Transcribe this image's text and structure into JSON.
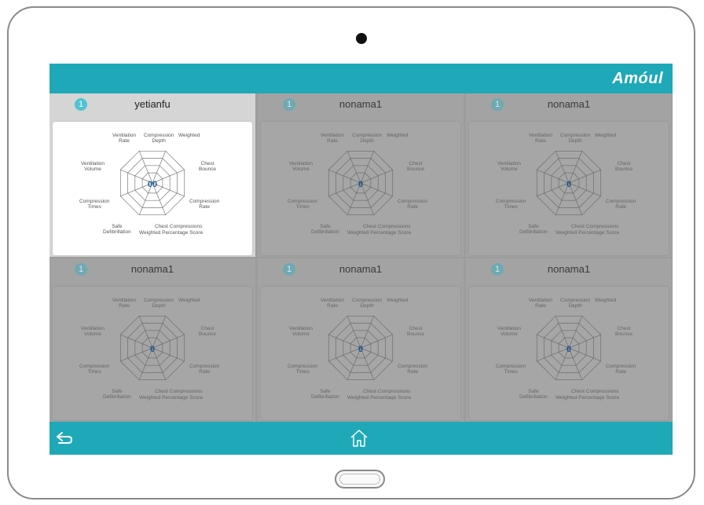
{
  "app": {
    "brand": "Amóul"
  },
  "labels": {
    "ventilation_rate": "Ventilation\nRate",
    "compression_depth": "Compression\nDepth",
    "weighted": "Weighted",
    "ventilation_volume": "Ventilation\nVolume",
    "chest_bounce": "Chest\nBounce",
    "compression_times": "Compression\nTimes",
    "compression_rate": "Compression\nRate",
    "safe_defibrillation": "Safe\nDefibrillation",
    "chest_compressions": "Chest Compressions",
    "weighted_percentage_score": "Weighted Percentage Score"
  },
  "panels": [
    {
      "badge": "1",
      "name": "yetianfu",
      "center": "00",
      "active": true
    },
    {
      "badge": "1",
      "name": "nonama1",
      "center": "0",
      "active": false
    },
    {
      "badge": "1",
      "name": "nonama1",
      "center": "0",
      "active": false
    },
    {
      "badge": "1",
      "name": "nonama1",
      "center": "0",
      "active": false
    },
    {
      "badge": "1",
      "name": "nonama1",
      "center": "0",
      "active": false
    },
    {
      "badge": "1",
      "name": "nonama1",
      "center": "0",
      "active": false
    }
  ],
  "footer": {
    "back_icon": "back-arrow-icon",
    "home_icon": "home-icon"
  },
  "colors": {
    "accent": "#1fa9b8",
    "badge": "#4fc3d5",
    "center_value": "#1f5f9a"
  }
}
